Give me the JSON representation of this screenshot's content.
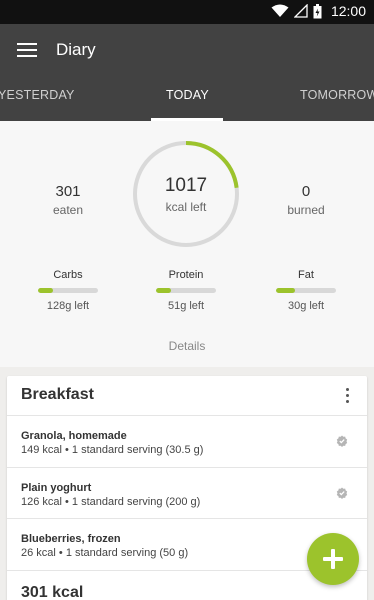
{
  "status_bar": {
    "time": "12:00",
    "icons": [
      "wifi-icon",
      "signal-icon",
      "battery-icon"
    ]
  },
  "app_bar": {
    "title": "Diary",
    "tabs": [
      {
        "label": "YESTERDAY",
        "selected": false
      },
      {
        "label": "TODAY",
        "selected": true
      },
      {
        "label": "TOMORROW",
        "selected": false
      }
    ]
  },
  "summary": {
    "eaten": {
      "value": "301",
      "label": "eaten"
    },
    "remaining": {
      "value": "1017",
      "label": "kcal left",
      "progress": 0.23
    },
    "burned": {
      "value": "0",
      "label": "burned"
    },
    "macros": [
      {
        "name": "Carbs",
        "left": "128g left",
        "progress": 0.25
      },
      {
        "name": "Protein",
        "left": "51g left",
        "progress": 0.25
      },
      {
        "name": "Fat",
        "left": "30g left",
        "progress": 0.32
      }
    ],
    "details_label": "Details"
  },
  "meal": {
    "title": "Breakfast",
    "items": [
      {
        "name": "Granola, homemade",
        "info": "149 kcal • 1 standard serving (30.5 g)"
      },
      {
        "name": "Plain yoghurt",
        "info": "126 kcal • 1 standard serving (200 g)"
      },
      {
        "name": "Blueberries, frozen",
        "info": "26 kcal • 1 standard serving (50 g)"
      }
    ],
    "total": "301 kcal"
  },
  "colors": {
    "accent": "#9cc32c",
    "app_bar": "#424242",
    "status_bar": "#111111"
  }
}
